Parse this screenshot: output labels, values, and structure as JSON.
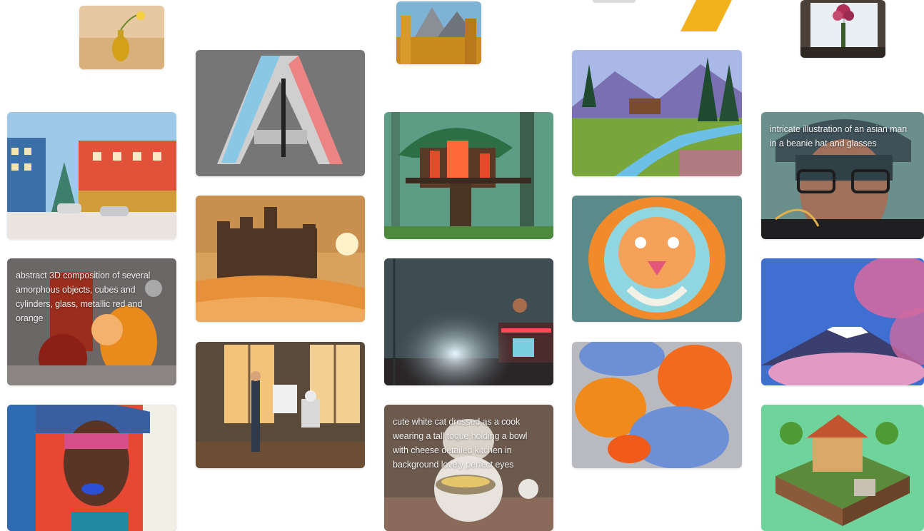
{
  "gallery": {
    "captions": {
      "asian_man": "intricate illustration of an asian man in a beanie hat and glasses",
      "abstract_3d": "abstract 3D composition of several amorphous objects, cubes and cylinders, glass, metallic red and orange",
      "cat_cook": "cute white cat dressed as a cook wearing a tall toque holding a bowl with cheese detailed kitchen in background lovely perfect eyes"
    },
    "accent_colors": {
      "slash": "#f2b21b",
      "background": "#ffffff"
    }
  }
}
